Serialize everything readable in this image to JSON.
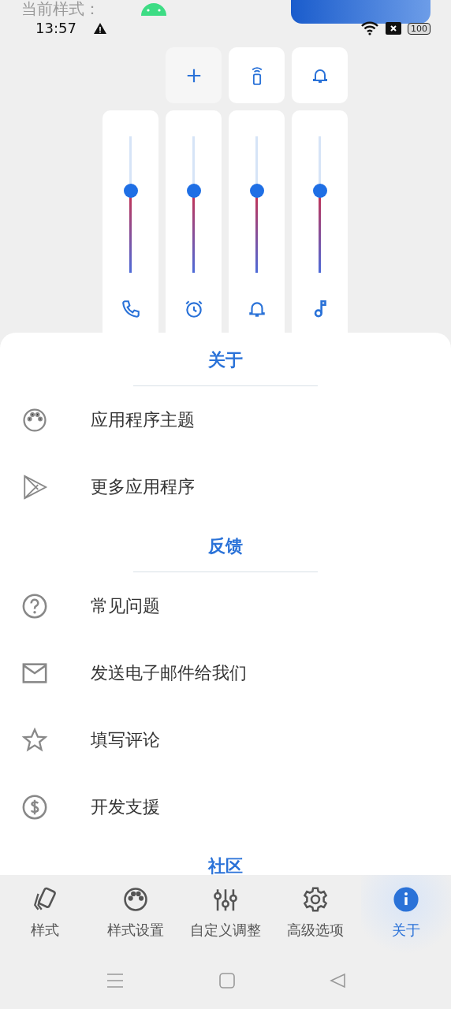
{
  "background_label": "当前样式：",
  "status_bar": {
    "time": "13:57",
    "battery": "100"
  },
  "quick_buttons": [
    {
      "kind": "add"
    },
    {
      "kind": "remote"
    },
    {
      "kind": "bell"
    }
  ],
  "sliders": [
    {
      "kind": "phone",
      "level": 0.6
    },
    {
      "kind": "alarm",
      "level": 0.6
    },
    {
      "kind": "bell",
      "level": 0.6
    },
    {
      "kind": "music",
      "level": 0.6
    }
  ],
  "sections": [
    {
      "title": "关于",
      "items": [
        {
          "kind": "palette",
          "label": "应用程序主题"
        },
        {
          "kind": "play",
          "label": "更多应用程序"
        }
      ]
    },
    {
      "title": "反馈",
      "items": [
        {
          "kind": "help",
          "label": "常见问题"
        },
        {
          "kind": "mail",
          "label": "发送电子邮件给我们"
        },
        {
          "kind": "star",
          "label": "填写评论"
        },
        {
          "kind": "dollar",
          "label": "开发支援"
        }
      ]
    },
    {
      "title": "社区"
    }
  ],
  "bottom_nav": [
    {
      "kind": "cards",
      "label": "样式",
      "selected": false
    },
    {
      "kind": "palette",
      "label": "样式设置",
      "selected": false
    },
    {
      "kind": "sliders",
      "label": "自定义调整",
      "selected": false
    },
    {
      "kind": "gear",
      "label": "高级选项",
      "selected": false
    },
    {
      "kind": "info",
      "label": "关于",
      "selected": true
    }
  ]
}
